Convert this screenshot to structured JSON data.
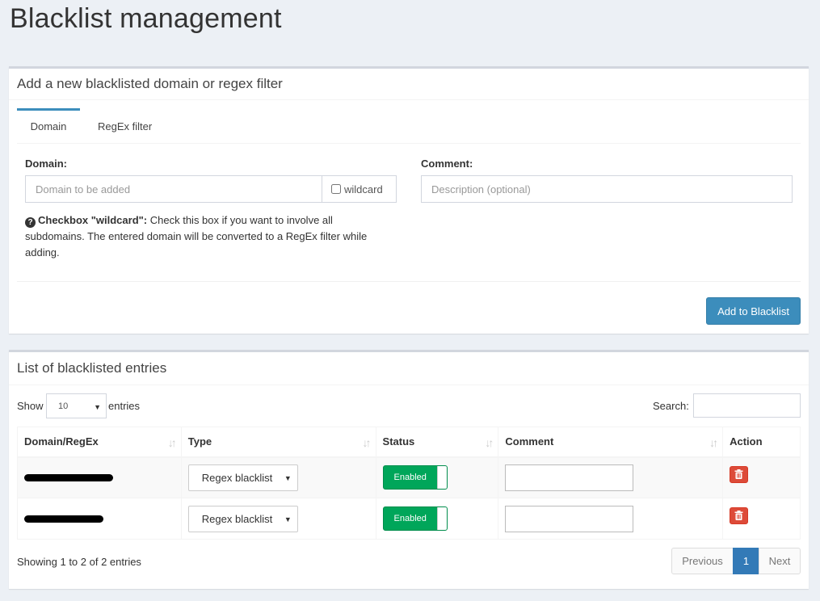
{
  "page": {
    "title": "Blacklist management"
  },
  "add_box": {
    "title": "Add a new blacklisted domain or regex filter",
    "tabs": [
      {
        "label": "Domain",
        "active": true
      },
      {
        "label": "RegEx filter",
        "active": false
      }
    ],
    "domain_label": "Domain:",
    "domain_placeholder": "Domain to be added",
    "wildcard_label": "wildcard",
    "comment_label": "Comment:",
    "comment_placeholder": "Description (optional)",
    "help_title": "Checkbox \"wildcard\":",
    "help_body": " Check this box if you want to involve all subdomains. The entered domain will be converted to a RegEx filter while adding.",
    "submit_label": "Add to Blacklist"
  },
  "list_box": {
    "title": "List of blacklisted entries",
    "show_label": "Show",
    "page_length": "10",
    "entries_label": "entries",
    "search_label": "Search:",
    "columns": [
      "Domain/RegEx",
      "Type",
      "Status",
      "Comment",
      "Action"
    ],
    "rows": [
      {
        "type": "Regex blacklist",
        "status": "Enabled",
        "comment": ""
      },
      {
        "type": "Regex blacklist",
        "status": "Enabled",
        "comment": ""
      }
    ],
    "info": "Showing 1 to 2 of 2 entries",
    "pagination": {
      "previous": "Previous",
      "current": "1",
      "next": "Next"
    }
  },
  "colors": {
    "primary": "#3c8dbc",
    "success": "#00a65a",
    "danger": "#dd4b39"
  }
}
